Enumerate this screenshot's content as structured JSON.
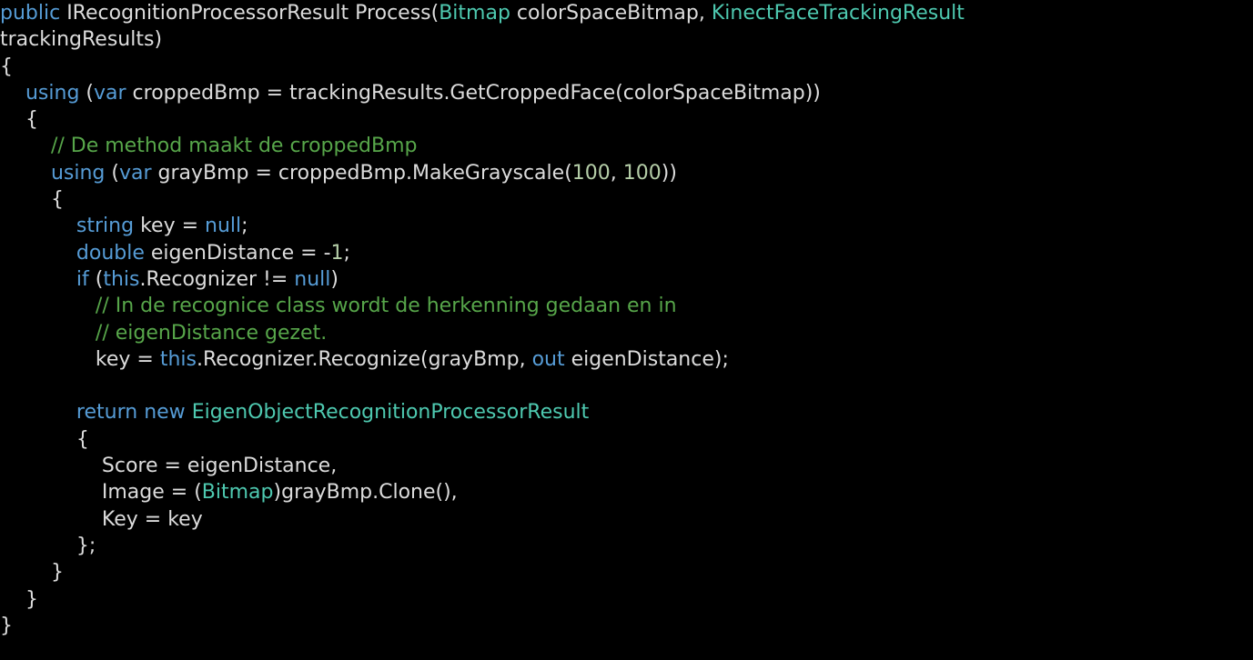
{
  "colors": {
    "background": "#000000",
    "plain": "#dcdcdc",
    "keyword": "#569cd6",
    "type": "#4ec9b0",
    "comment": "#57a64a",
    "number": "#b5cea8"
  },
  "code": {
    "lines": [
      {
        "tokens": [
          {
            "k": "kw",
            "t": "public"
          },
          {
            "k": "plain",
            "t": " IRecognitionProcessorResult Process("
          },
          {
            "k": "type",
            "t": "Bitmap"
          },
          {
            "k": "plain",
            "t": " colorSpaceBitmap, "
          },
          {
            "k": "type",
            "t": "KinectFaceTrackingResult"
          }
        ]
      },
      {
        "tokens": [
          {
            "k": "plain",
            "t": "trackingResults)"
          }
        ]
      },
      {
        "tokens": [
          {
            "k": "plain",
            "t": "{"
          }
        ]
      },
      {
        "tokens": [
          {
            "k": "plain",
            "t": "    "
          },
          {
            "k": "kw",
            "t": "using"
          },
          {
            "k": "plain",
            "t": " ("
          },
          {
            "k": "kw",
            "t": "var"
          },
          {
            "k": "plain",
            "t": " croppedBmp = trackingResults.GetCroppedFace(colorSpaceBitmap))"
          }
        ]
      },
      {
        "tokens": [
          {
            "k": "plain",
            "t": "    {"
          }
        ]
      },
      {
        "tokens": [
          {
            "k": "plain",
            "t": "        "
          },
          {
            "k": "comment",
            "t": "// De method maakt de croppedBmp"
          }
        ]
      },
      {
        "tokens": [
          {
            "k": "plain",
            "t": "        "
          },
          {
            "k": "kw",
            "t": "using"
          },
          {
            "k": "plain",
            "t": " ("
          },
          {
            "k": "kw",
            "t": "var"
          },
          {
            "k": "plain",
            "t": " grayBmp = croppedBmp.MakeGrayscale("
          },
          {
            "k": "num",
            "t": "100"
          },
          {
            "k": "plain",
            "t": ", "
          },
          {
            "k": "num",
            "t": "100"
          },
          {
            "k": "plain",
            "t": "))"
          }
        ]
      },
      {
        "tokens": [
          {
            "k": "plain",
            "t": "        {"
          }
        ]
      },
      {
        "tokens": [
          {
            "k": "plain",
            "t": "            "
          },
          {
            "k": "kw",
            "t": "string"
          },
          {
            "k": "plain",
            "t": " key = "
          },
          {
            "k": "kw",
            "t": "null"
          },
          {
            "k": "plain",
            "t": ";"
          }
        ]
      },
      {
        "tokens": [
          {
            "k": "plain",
            "t": "            "
          },
          {
            "k": "kw",
            "t": "double"
          },
          {
            "k": "plain",
            "t": " eigenDistance = -"
          },
          {
            "k": "num",
            "t": "1"
          },
          {
            "k": "plain",
            "t": ";"
          }
        ]
      },
      {
        "tokens": [
          {
            "k": "plain",
            "t": "            "
          },
          {
            "k": "kw",
            "t": "if"
          },
          {
            "k": "plain",
            "t": " ("
          },
          {
            "k": "kw",
            "t": "this"
          },
          {
            "k": "plain",
            "t": ".Recognizer != "
          },
          {
            "k": "kw",
            "t": "null"
          },
          {
            "k": "plain",
            "t": ")"
          }
        ]
      },
      {
        "tokens": [
          {
            "k": "plain",
            "t": "               "
          },
          {
            "k": "comment",
            "t": "// In de recognice class wordt de herkenning gedaan en in"
          }
        ]
      },
      {
        "tokens": [
          {
            "k": "plain",
            "t": "               "
          },
          {
            "k": "comment",
            "t": "// eigenDistance gezet."
          }
        ]
      },
      {
        "tokens": [
          {
            "k": "plain",
            "t": "               key = "
          },
          {
            "k": "kw",
            "t": "this"
          },
          {
            "k": "plain",
            "t": ".Recognizer.Recognize(grayBmp, "
          },
          {
            "k": "kw",
            "t": "out"
          },
          {
            "k": "plain",
            "t": " eigenDistance);"
          }
        ]
      },
      {
        "tokens": [
          {
            "k": "plain",
            "t": ""
          }
        ]
      },
      {
        "tokens": [
          {
            "k": "plain",
            "t": "            "
          },
          {
            "k": "kw",
            "t": "return"
          },
          {
            "k": "plain",
            "t": " "
          },
          {
            "k": "kw",
            "t": "new"
          },
          {
            "k": "plain",
            "t": " "
          },
          {
            "k": "type",
            "t": "EigenObjectRecognitionProcessorResult"
          }
        ]
      },
      {
        "tokens": [
          {
            "k": "plain",
            "t": "            {"
          }
        ]
      },
      {
        "tokens": [
          {
            "k": "plain",
            "t": "                Score = eigenDistance,"
          }
        ]
      },
      {
        "tokens": [
          {
            "k": "plain",
            "t": "                Image = ("
          },
          {
            "k": "type",
            "t": "Bitmap"
          },
          {
            "k": "plain",
            "t": ")grayBmp.Clone(),"
          }
        ]
      },
      {
        "tokens": [
          {
            "k": "plain",
            "t": "                Key = key"
          }
        ]
      },
      {
        "tokens": [
          {
            "k": "plain",
            "t": "            };"
          }
        ]
      },
      {
        "tokens": [
          {
            "k": "plain",
            "t": "        }"
          }
        ]
      },
      {
        "tokens": [
          {
            "k": "plain",
            "t": "    }"
          }
        ]
      },
      {
        "tokens": [
          {
            "k": "plain",
            "t": "}"
          }
        ]
      }
    ]
  }
}
